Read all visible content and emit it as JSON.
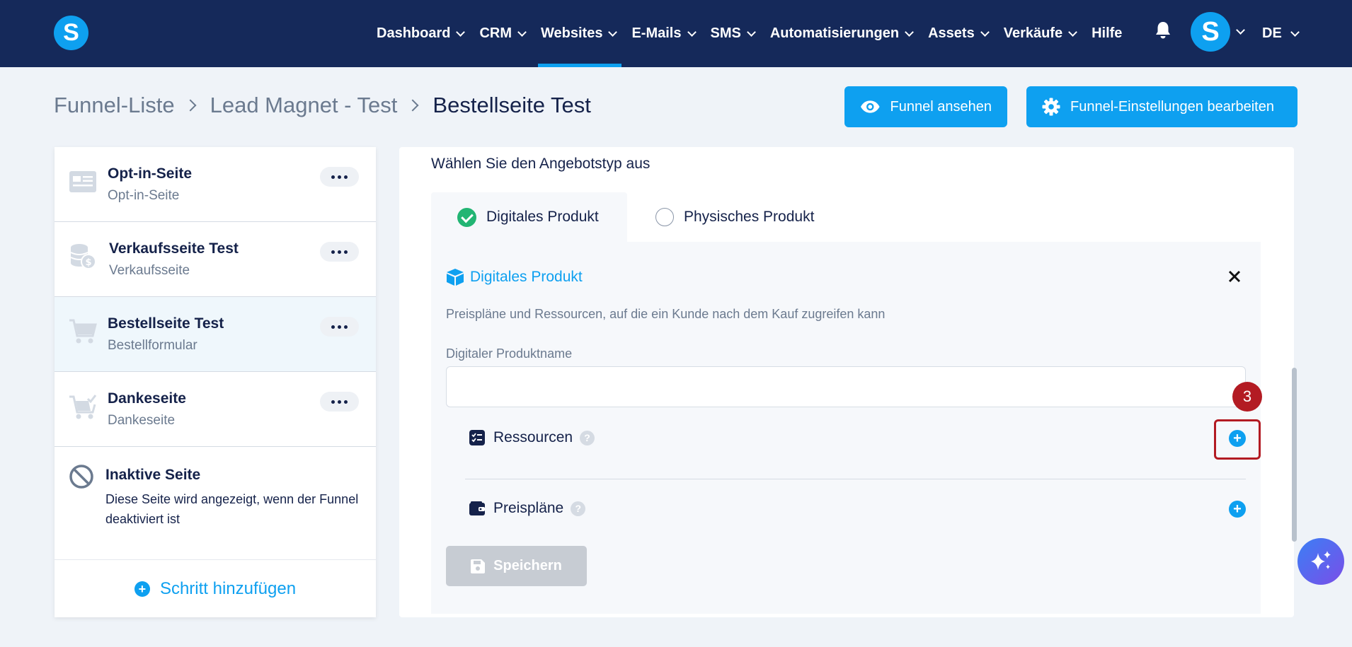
{
  "nav": {
    "logo": "S",
    "items": [
      {
        "label": "Dashboard",
        "dropdown": true
      },
      {
        "label": "CRM",
        "dropdown": true
      },
      {
        "label": "Websites",
        "dropdown": true,
        "active": true
      },
      {
        "label": "E-Mails",
        "dropdown": true
      },
      {
        "label": "SMS",
        "dropdown": true
      },
      {
        "label": "Automatisierungen",
        "dropdown": true
      },
      {
        "label": "Assets",
        "dropdown": true
      },
      {
        "label": "Verkäufe",
        "dropdown": true
      },
      {
        "label": "Hilfe",
        "dropdown": false
      }
    ],
    "avatar": "S",
    "language": "DE"
  },
  "breadcrumb": {
    "items": [
      "Funnel-Liste",
      "Lead Magnet - Test"
    ],
    "current": "Bestellseite Test"
  },
  "header_buttons": {
    "view_funnel": "Funnel ansehen",
    "edit_settings": "Funnel-Einstellungen bearbeiten"
  },
  "steps": [
    {
      "title": "Opt-in-Seite",
      "subtitle": "Opt-in-Seite",
      "icon": "optin-page-icon",
      "selected": false
    },
    {
      "title": "Verkaufsseite Test",
      "subtitle": "Verkaufsseite",
      "icon": "coins-icon",
      "selected": false
    },
    {
      "title": "Bestellseite Test",
      "subtitle": "Bestellformular",
      "icon": "cart-icon",
      "selected": true
    },
    {
      "title": "Dankeseite",
      "subtitle": "Dankeseite",
      "icon": "cart-check-icon",
      "selected": false
    }
  ],
  "inactive_page": {
    "title": "Inaktive Seite",
    "description": "Diese Seite wird angezeigt, wenn der Funnel deaktiviert ist"
  },
  "add_step": "Schritt hinzufügen",
  "offer": {
    "label": "Wählen Sie den Angebotstyp aus",
    "tabs": [
      {
        "label": "Digitales Produkt",
        "selected": true
      },
      {
        "label": "Physisches Produkt",
        "selected": false
      }
    ],
    "product": {
      "title": "Digitales Produkt",
      "description": "Preispläne und Ressourcen, auf die ein Kunde nach dem Kauf zugreifen kann",
      "name_label": "Digitaler Produktname",
      "name_value": "",
      "step_badge": "3",
      "resources_label": "Ressourcen",
      "pricing_label": "Preispläne",
      "help_glyph": "?",
      "add_glyph": "+",
      "save_label": "Speichern"
    }
  },
  "colors": {
    "navbar": "#15295a",
    "accent": "#0ea0f0",
    "success": "#22b573",
    "highlight": "#b31b23"
  }
}
